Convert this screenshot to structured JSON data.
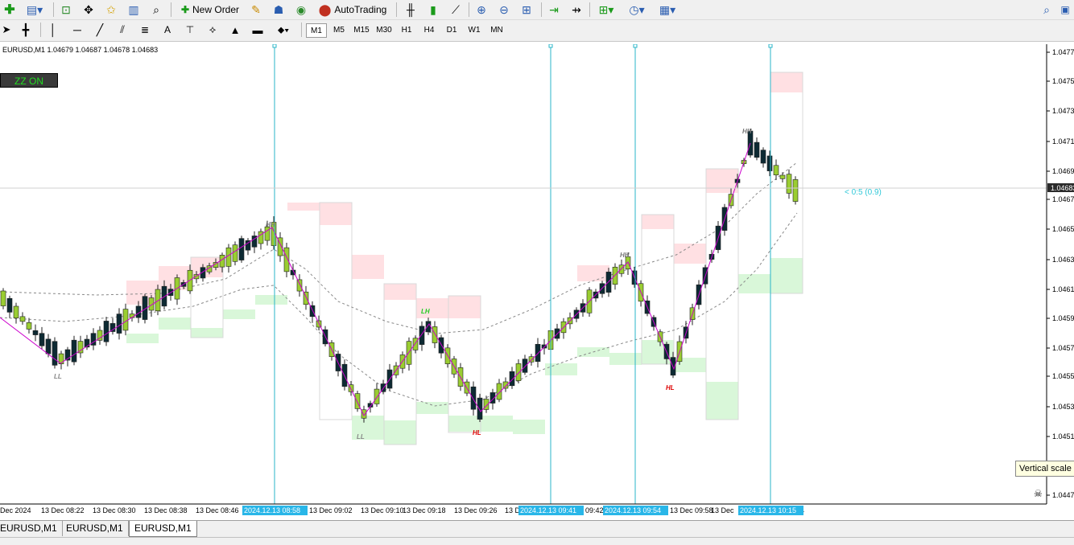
{
  "toolbar": {
    "new_order_label": "New Order",
    "autotrading_label": "AutoTrading",
    "timeframes": [
      "M1",
      "M5",
      "M15",
      "M30",
      "H1",
      "H4",
      "D1",
      "W1",
      "MN"
    ],
    "active_timeframe": "M1"
  },
  "chart": {
    "info": "EURUSD,M1  1.04679 1.04687 1.04678 1.04683",
    "zz_label": "ZZ ON",
    "price_labels": [
      "1.04770",
      "1.04750",
      "1.04730",
      "1.04710",
      "1.04690",
      "1.04670",
      "1.04650",
      "1.04630",
      "1.04610",
      "1.04590",
      "1.04570",
      "1.04550",
      "1.04530",
      "1.04510",
      "1.04470"
    ],
    "current_price": "1.04683",
    "countdown": "< 0:5 (0.9)",
    "time_labels": [
      "Dec 2024",
      "13 Dec 08:22",
      "13 Dec 08:30",
      "13 Dec 08:38",
      "13 Dec 08:46",
      "13 Dec 09:02",
      "13 Dec 09:10",
      "13 Dec 09:18",
      "13 Dec 09:26",
      "13 D",
      "09:42",
      "13 Dec 09:58",
      "13 Dec",
      "4"
    ],
    "vline_labels": [
      "2024.12.13 08:58",
      "2024.12.13 09:41",
      "2024.12.13 09:54",
      "2024.12.13 10:15"
    ],
    "swing_labels": [
      "LL",
      "HH",
      "LL",
      "LH",
      "HL",
      "HH",
      "HL",
      "HH"
    ],
    "tooltip": "Vertical scale"
  },
  "tabs": [
    "EURUSD,M1",
    "EURUSD,M1",
    "EURUSD,M1"
  ],
  "colors": {
    "bull_candle": "#9acd32",
    "bear_candle": "#0d2a33",
    "zigzag": "#cc00cc",
    "vline": "#29b6c8",
    "supply": "#ffe0e3",
    "demand": "#d9f7d9"
  }
}
